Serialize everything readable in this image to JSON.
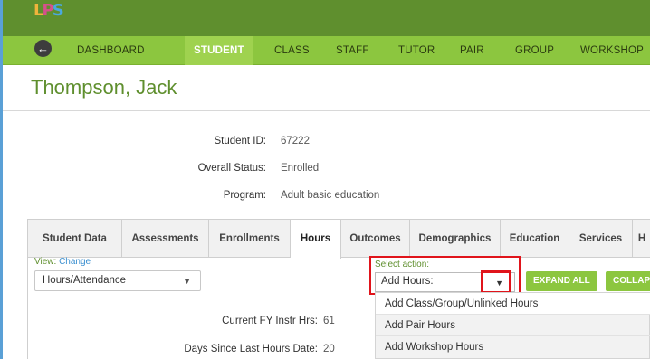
{
  "app": {
    "logo_text": "LPS"
  },
  "nav": {
    "items": [
      {
        "label": "DASHBOARD"
      },
      {
        "label": "STUDENT"
      },
      {
        "label": "CLASS"
      },
      {
        "label": "STAFF"
      },
      {
        "label": "TUTOR"
      },
      {
        "label": "PAIR"
      },
      {
        "label": "GROUP"
      },
      {
        "label": "WORKSHOP"
      }
    ],
    "active": "STUDENT",
    "back_icon": "arrow-left-icon"
  },
  "page": {
    "title": "Thompson, Jack"
  },
  "student_info": {
    "id_label": "Student ID:",
    "id_value": "67222",
    "status_label": "Overall Status:",
    "status_value": "Enrolled",
    "program_label": "Program:",
    "program_value": "Adult basic education"
  },
  "tabs": [
    {
      "label": "Student Data"
    },
    {
      "label": "Assessments"
    },
    {
      "label": "Enrollments"
    },
    {
      "label": "Hours"
    },
    {
      "label": "Outcomes"
    },
    {
      "label": "Demographics"
    },
    {
      "label": "Education"
    },
    {
      "label": "Services"
    },
    {
      "label": "H"
    }
  ],
  "active_tab": "Hours",
  "view": {
    "label": "View:",
    "change_link": "Change",
    "selected": "Hours/Attendance"
  },
  "stats": {
    "fy_label": "Current FY Instr Hrs:",
    "fy_value": "61",
    "days_label": "Days Since Last Hours Date:",
    "days_value": "20"
  },
  "action": {
    "label": "Select action:",
    "selected": "Add Hours:",
    "expand_all": "EXPAND ALL",
    "collapse": "COLLAPS",
    "options": [
      {
        "label": "Add Class/Group/Unlinked Hours"
      },
      {
        "label": "Add Pair Hours"
      },
      {
        "label": "Add Workshop Hours"
      }
    ]
  },
  "colors": {
    "topbar": "#5f8f2e",
    "navbar": "#8cc63f",
    "nav_active": "#9fd24f",
    "title": "#5f8f2e",
    "highlight": "#e0141b"
  }
}
